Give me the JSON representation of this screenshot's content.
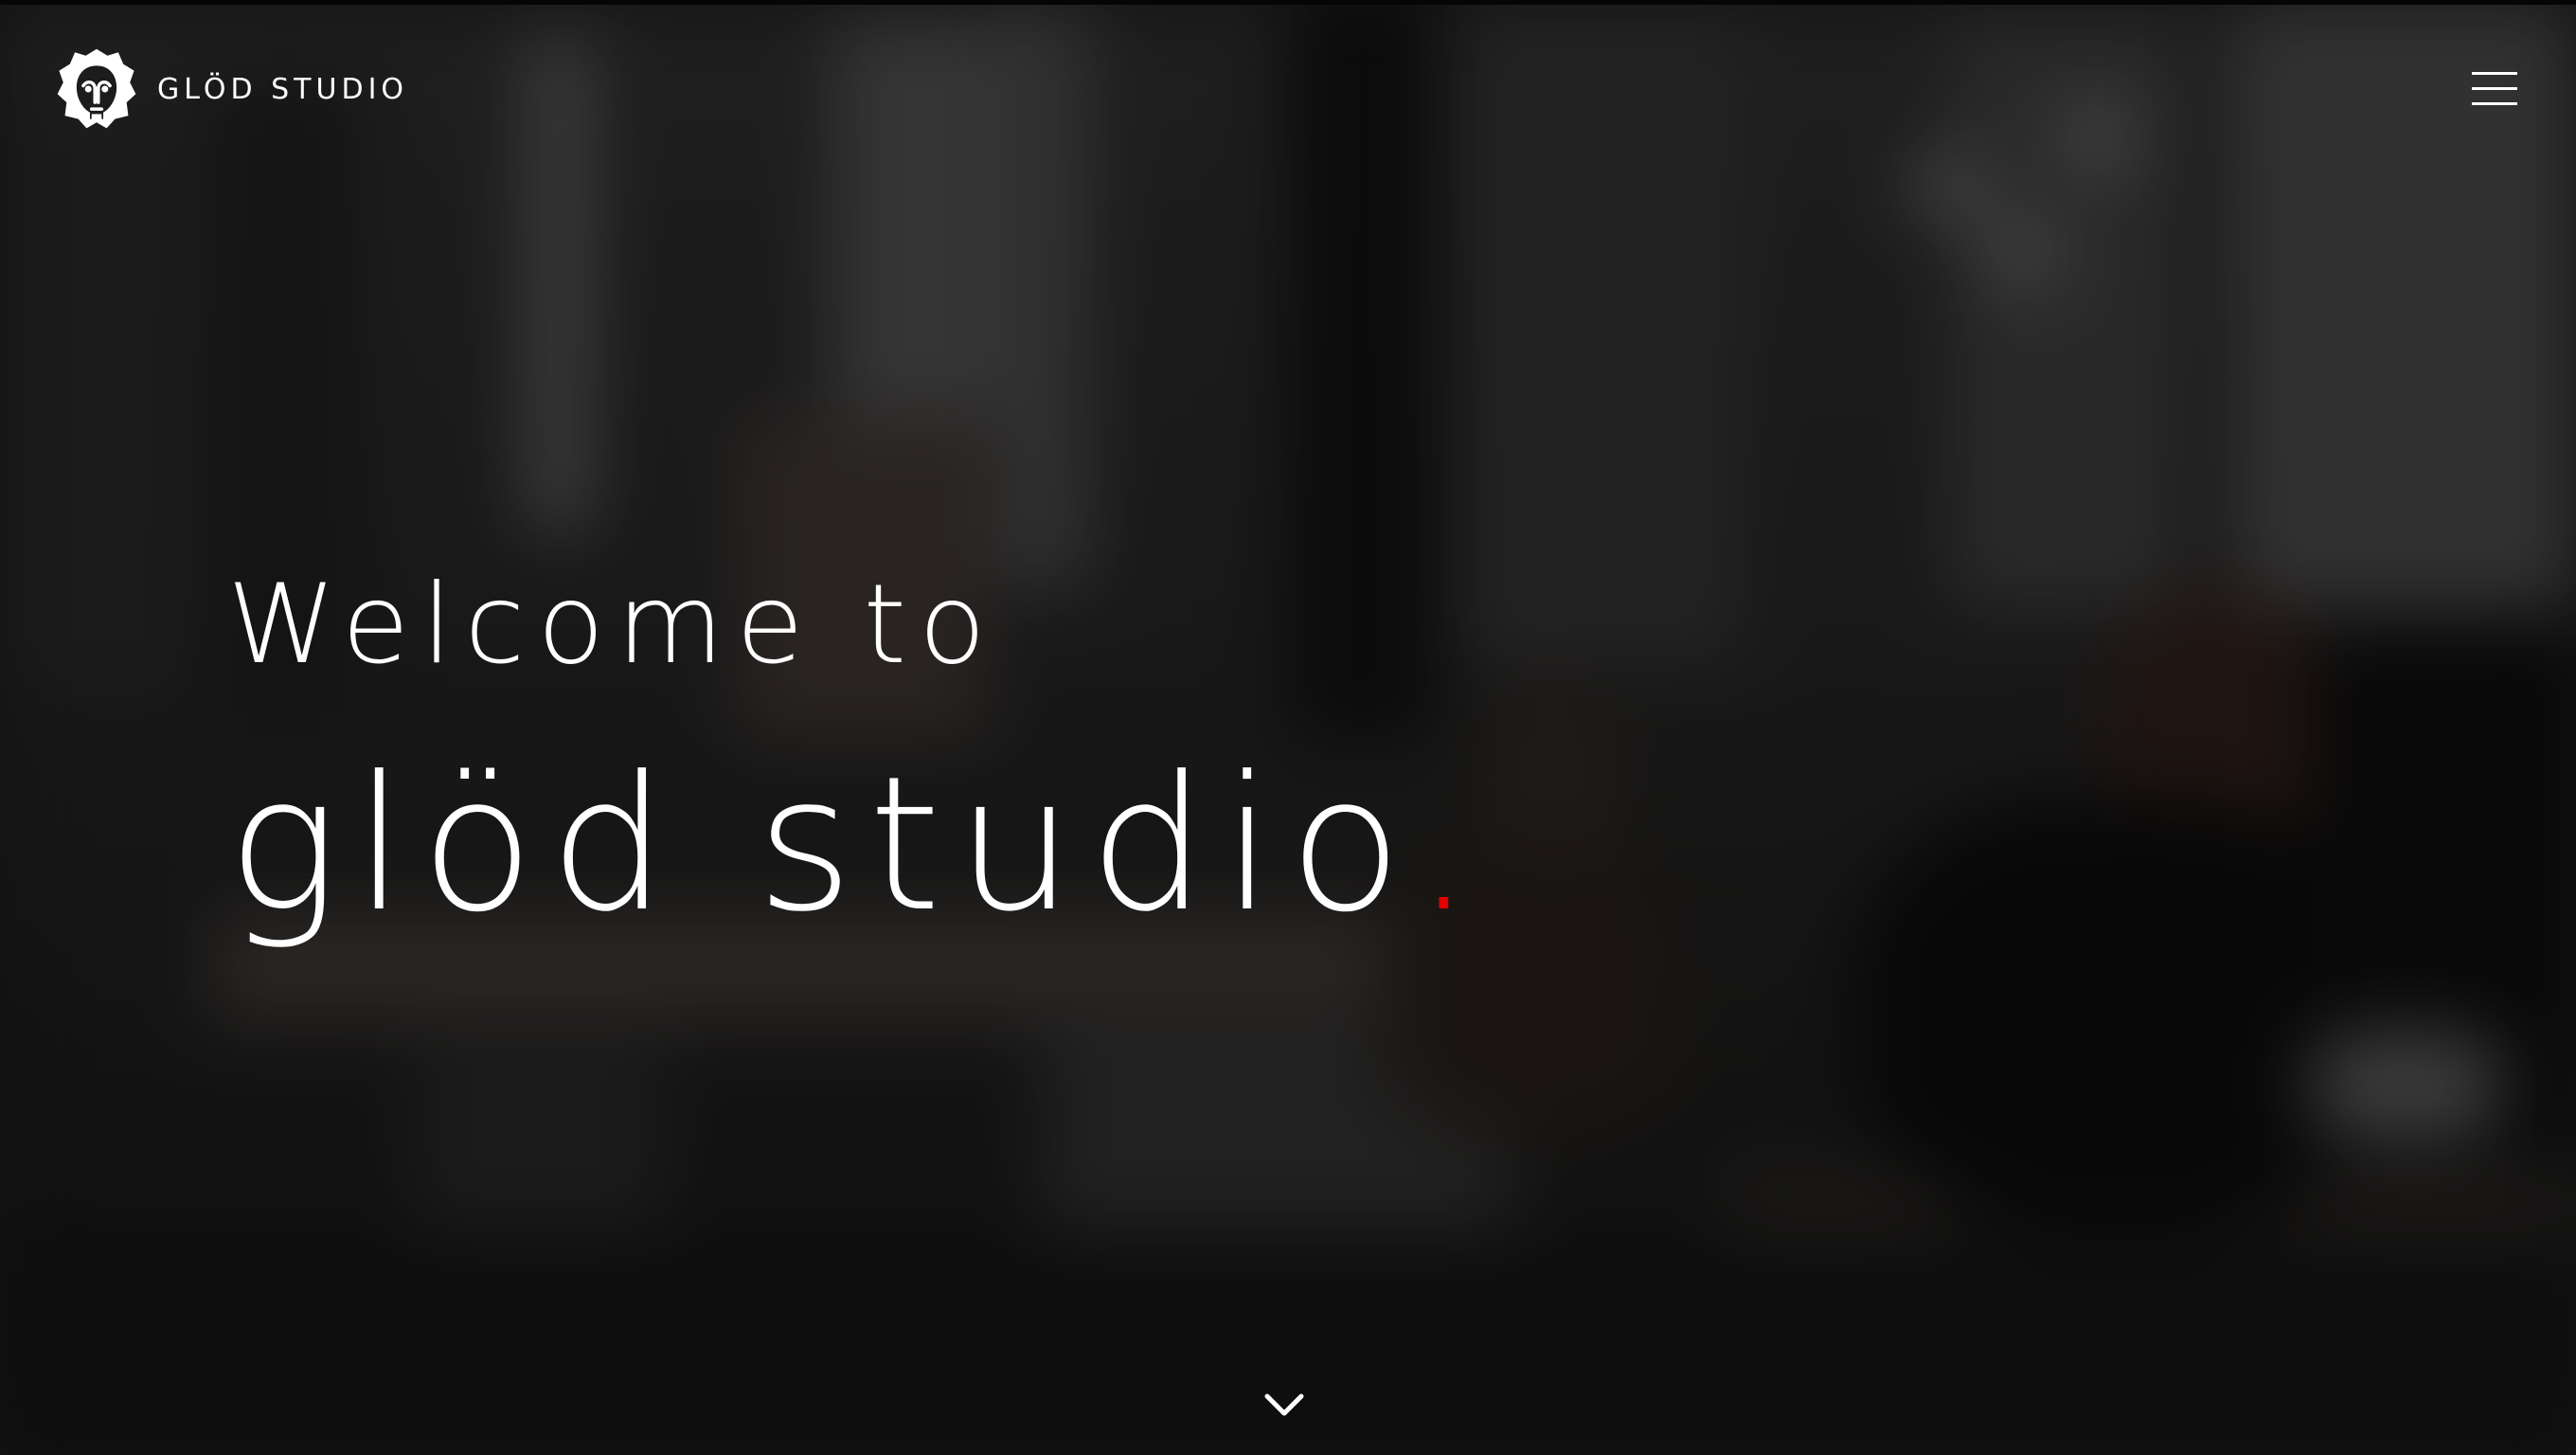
{
  "header": {
    "brand_name": "GLÖD STUDIO",
    "logo_icon": "lion-head-logo-icon",
    "menu_icon": "hamburger-menu-icon"
  },
  "hero": {
    "line1": "Welcome to",
    "line2": "glöd studio",
    "line2_dot": ".",
    "accent_color": "#e00000"
  },
  "scroll": {
    "icon": "chevron-down-icon"
  }
}
